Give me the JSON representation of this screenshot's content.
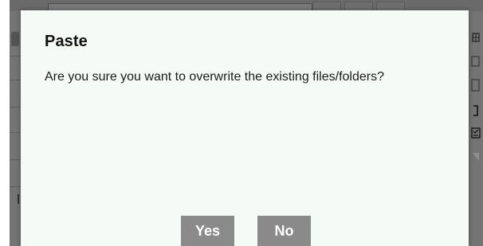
{
  "dialog": {
    "title": "Paste",
    "message": "Are you sure you want to overwrite the existing files/folders?",
    "buttons": {
      "yes_label": "Yes",
      "no_label": "No"
    }
  },
  "colors": {
    "dialog_background": "#f4faf6",
    "button_background": "#8a8a8a",
    "button_text": "#ffffff",
    "backdrop": "#747474"
  },
  "background_icons": [
    "grid-icon",
    "copy-icon",
    "file-icon",
    "bracket-icon",
    "checklist-icon",
    "arrow-icon"
  ]
}
